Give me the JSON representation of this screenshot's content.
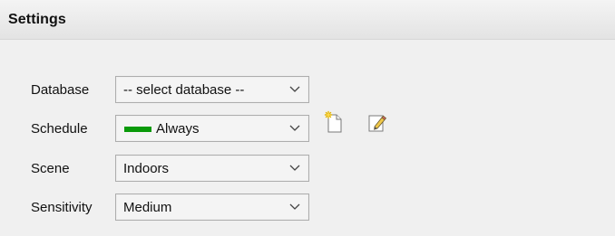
{
  "header": {
    "title": "Settings"
  },
  "rows": [
    {
      "label": "Database",
      "value": "-- select database --"
    },
    {
      "label": "Schedule",
      "value": "Always",
      "swatch_color": "#0a9a0a",
      "actions": [
        {
          "icon": "new-document-icon"
        },
        {
          "icon": "edit-icon"
        }
      ]
    },
    {
      "label": "Scene",
      "value": "Indoors"
    },
    {
      "label": "Sensitivity",
      "value": "Medium"
    }
  ],
  "colors": {
    "background": "#f0f0f0",
    "header_background": "#e8e8e8",
    "combo_border": "#adadad",
    "schedule_green": "#0a9a0a"
  }
}
